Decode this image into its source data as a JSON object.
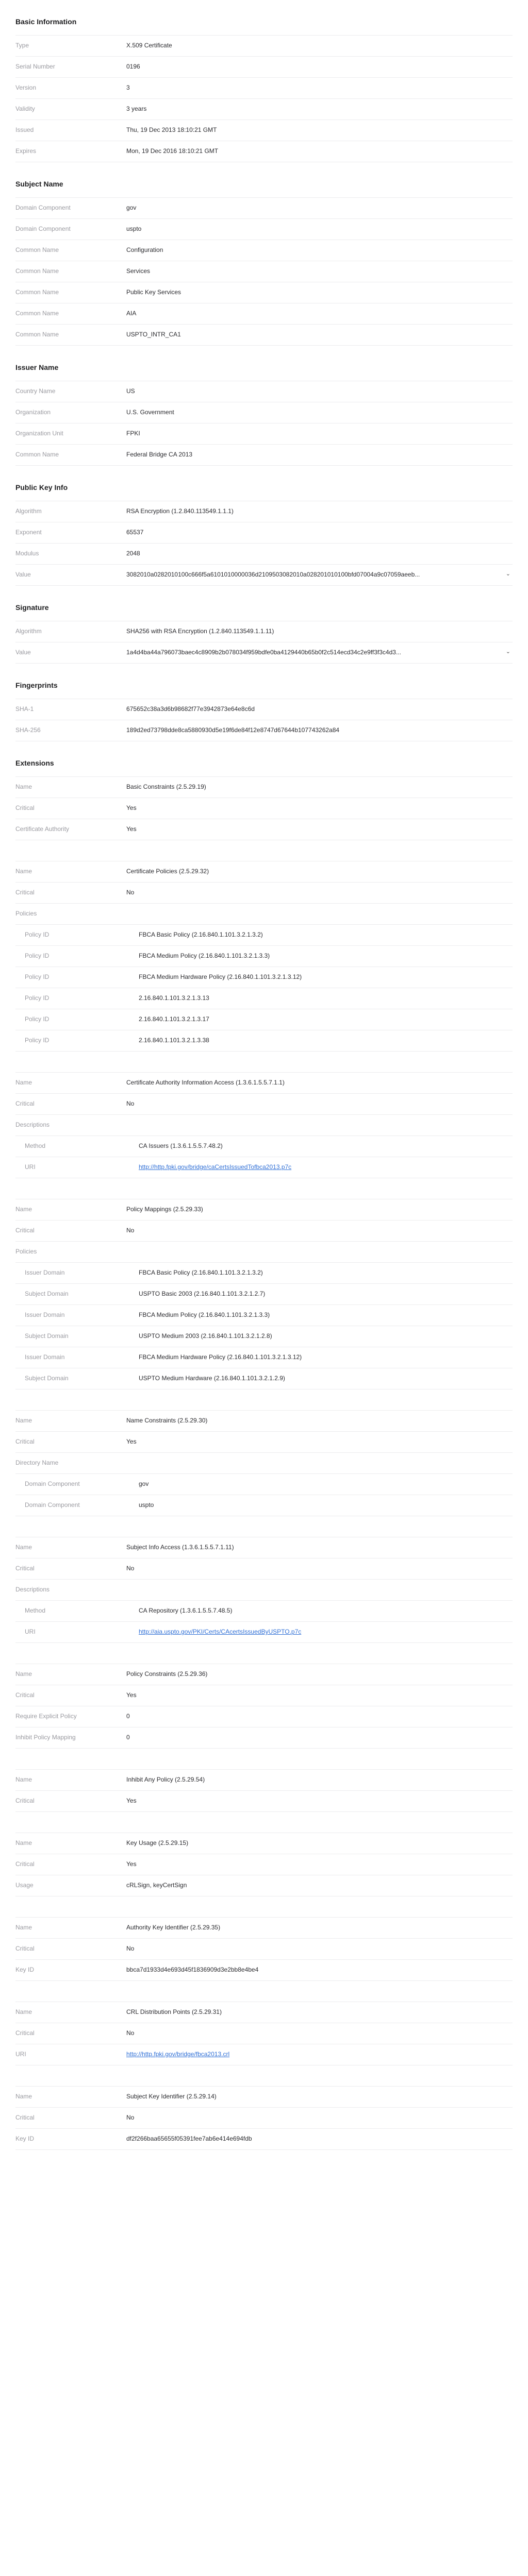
{
  "sections": {
    "basic": "Basic Information",
    "subject": "Subject Name",
    "issuer": "Issuer Name",
    "pubkey": "Public Key Info",
    "signature": "Signature",
    "fingerprints": "Fingerprints",
    "extensions": "Extensions"
  },
  "basic": [
    [
      "Type",
      "X.509 Certificate"
    ],
    [
      "Serial Number",
      "0196"
    ],
    [
      "Version",
      "3"
    ],
    [
      "Validity",
      "3 years"
    ],
    [
      "Issued",
      "Thu, 19 Dec 2013 18:10:21 GMT"
    ],
    [
      "Expires",
      "Mon, 19 Dec 2016 18:10:21 GMT"
    ]
  ],
  "subject": [
    [
      "Domain Component",
      "gov"
    ],
    [
      "Domain Component",
      "uspto"
    ],
    [
      "Common Name",
      "Configuration"
    ],
    [
      "Common Name",
      "Services"
    ],
    [
      "Common Name",
      "Public Key Services"
    ],
    [
      "Common Name",
      "AIA"
    ],
    [
      "Common Name",
      "USPTO_INTR_CA1"
    ]
  ],
  "issuer": [
    [
      "Country Name",
      "US"
    ],
    [
      "Organization",
      "U.S. Government"
    ],
    [
      "Organization Unit",
      "FPKI"
    ],
    [
      "Common Name",
      "Federal Bridge CA 2013"
    ]
  ],
  "pubkey": [
    [
      "Algorithm",
      "RSA Encryption (1.2.840.113549.1.1.1)"
    ],
    [
      "Exponent",
      "65537"
    ],
    [
      "Modulus",
      "2048"
    ],
    [
      "Value",
      "3082010a0282010100c666f5a6101010000036d2109503082010a028201010100bfd07004a9c07059aeeb..."
    ]
  ],
  "signature": [
    [
      "Algorithm",
      "SHA256 with RSA Encryption (1.2.840.113549.1.1.11)"
    ],
    [
      "Value",
      "1a4d4ba44a796073baec4c8909b2b078034f959bdfe0ba4129440b65b0f2c514ecd34c2e9ff3f3c4d3..."
    ]
  ],
  "fingerprints": [
    [
      "SHA-1",
      "675652c38a3d6b98682f77e3942873e64e8c6d"
    ],
    [
      "SHA-256",
      "189d2ed73798dde8ca5880930d5e19f6de84f12e8747d67644b107743262a84"
    ]
  ],
  "ext": {
    "bc": [
      [
        "Name",
        "Basic Constraints (2.5.29.19)"
      ],
      [
        "Critical",
        "Yes"
      ],
      [
        "Certificate Authority",
        "Yes"
      ]
    ],
    "cp": [
      [
        "Name",
        "Certificate Policies (2.5.29.32)"
      ],
      [
        "Critical",
        "No"
      ]
    ],
    "policies_label": "Policies",
    "policies": [
      [
        "Policy ID",
        "FBCA Basic Policy (2.16.840.1.101.3.2.1.3.2)"
      ],
      [
        "Policy ID",
        "FBCA Medium Policy (2.16.840.1.101.3.2.1.3.3)"
      ],
      [
        "Policy ID",
        "FBCA Medium Hardware Policy (2.16.840.1.101.3.2.1.3.12)"
      ],
      [
        "Policy ID",
        "2.16.840.1.101.3.2.1.3.13"
      ],
      [
        "Policy ID",
        "2.16.840.1.101.3.2.1.3.17"
      ],
      [
        "Policy ID",
        "2.16.840.1.101.3.2.1.3.38"
      ]
    ],
    "aia": [
      [
        "Name",
        "Certificate Authority Information Access (1.3.6.1.5.5.7.1.1)"
      ],
      [
        "Critical",
        "No"
      ]
    ],
    "descriptions_label": "Descriptions",
    "aia_desc": [
      [
        "Method",
        "CA Issuers (1.3.6.1.5.5.7.48.2)"
      ],
      [
        "URI",
        "http://http.fpki.gov/bridge/caCertsIssuedTofbca2013.p7c"
      ]
    ],
    "pm": [
      [
        "Name",
        "Policy Mappings (2.5.29.33)"
      ],
      [
        "Critical",
        "No"
      ]
    ],
    "pm_list": [
      [
        "Issuer Domain",
        "FBCA Basic Policy (2.16.840.1.101.3.2.1.3.2)"
      ],
      [
        "Subject Domain",
        "USPTO Basic 2003 (2.16.840.1.101.3.2.1.2.7)"
      ],
      [
        "Issuer Domain",
        "FBCA Medium Policy (2.16.840.1.101.3.2.1.3.3)"
      ],
      [
        "Subject Domain",
        "USPTO Medium 2003 (2.16.840.1.101.3.2.1.2.8)"
      ],
      [
        "Issuer Domain",
        "FBCA Medium Hardware Policy (2.16.840.1.101.3.2.1.3.12)"
      ],
      [
        "Subject Domain",
        "USPTO Medium Hardware (2.16.840.1.101.3.2.1.2.9)"
      ]
    ],
    "nc": [
      [
        "Name",
        "Name Constraints (2.5.29.30)"
      ],
      [
        "Critical",
        "Yes"
      ]
    ],
    "dir_label": "Directory Name",
    "nc_list": [
      [
        "Domain Component",
        "gov"
      ],
      [
        "Domain Component",
        "uspto"
      ]
    ],
    "sia": [
      [
        "Name",
        "Subject Info Access (1.3.6.1.5.5.7.1.11)"
      ],
      [
        "Critical",
        "No"
      ]
    ],
    "sia_desc": [
      [
        "Method",
        "CA Repository (1.3.6.1.5.5.7.48.5)"
      ],
      [
        "URI",
        "http://aia.uspto.gov/PKI/Certs/CAcertsIssuedByUSPTO.p7c"
      ]
    ],
    "pc": [
      [
        "Name",
        "Policy Constraints (2.5.29.36)"
      ],
      [
        "Critical",
        "Yes"
      ],
      [
        "Require Explicit Policy",
        "0"
      ],
      [
        "Inhibit Policy Mapping",
        "0"
      ]
    ],
    "iap": [
      [
        "Name",
        "Inhibit Any Policy (2.5.29.54)"
      ],
      [
        "Critical",
        "Yes"
      ]
    ],
    "ku": [
      [
        "Name",
        "Key Usage (2.5.29.15)"
      ],
      [
        "Critical",
        "Yes"
      ],
      [
        "Usage",
        "cRLSign, keyCertSign"
      ]
    ],
    "aki": [
      [
        "Name",
        "Authority Key Identifier (2.5.29.35)"
      ],
      [
        "Critical",
        "No"
      ],
      [
        "Key ID",
        "bbca7d1933d4e693d45f1836909d3e2bb8e4be4"
      ]
    ],
    "crl": [
      [
        "Name",
        "CRL Distribution Points (2.5.29.31)"
      ],
      [
        "Critical",
        "No"
      ],
      [
        "URI",
        "http://http.fpki.gov/bridge/fbca2013.crl"
      ]
    ],
    "ski": [
      [
        "Name",
        "Subject Key Identifier (2.5.29.14)"
      ],
      [
        "Critical",
        "No"
      ],
      [
        "Key ID",
        "df2f266baa65655f05391fee7ab6e414e694fdb"
      ]
    ]
  }
}
